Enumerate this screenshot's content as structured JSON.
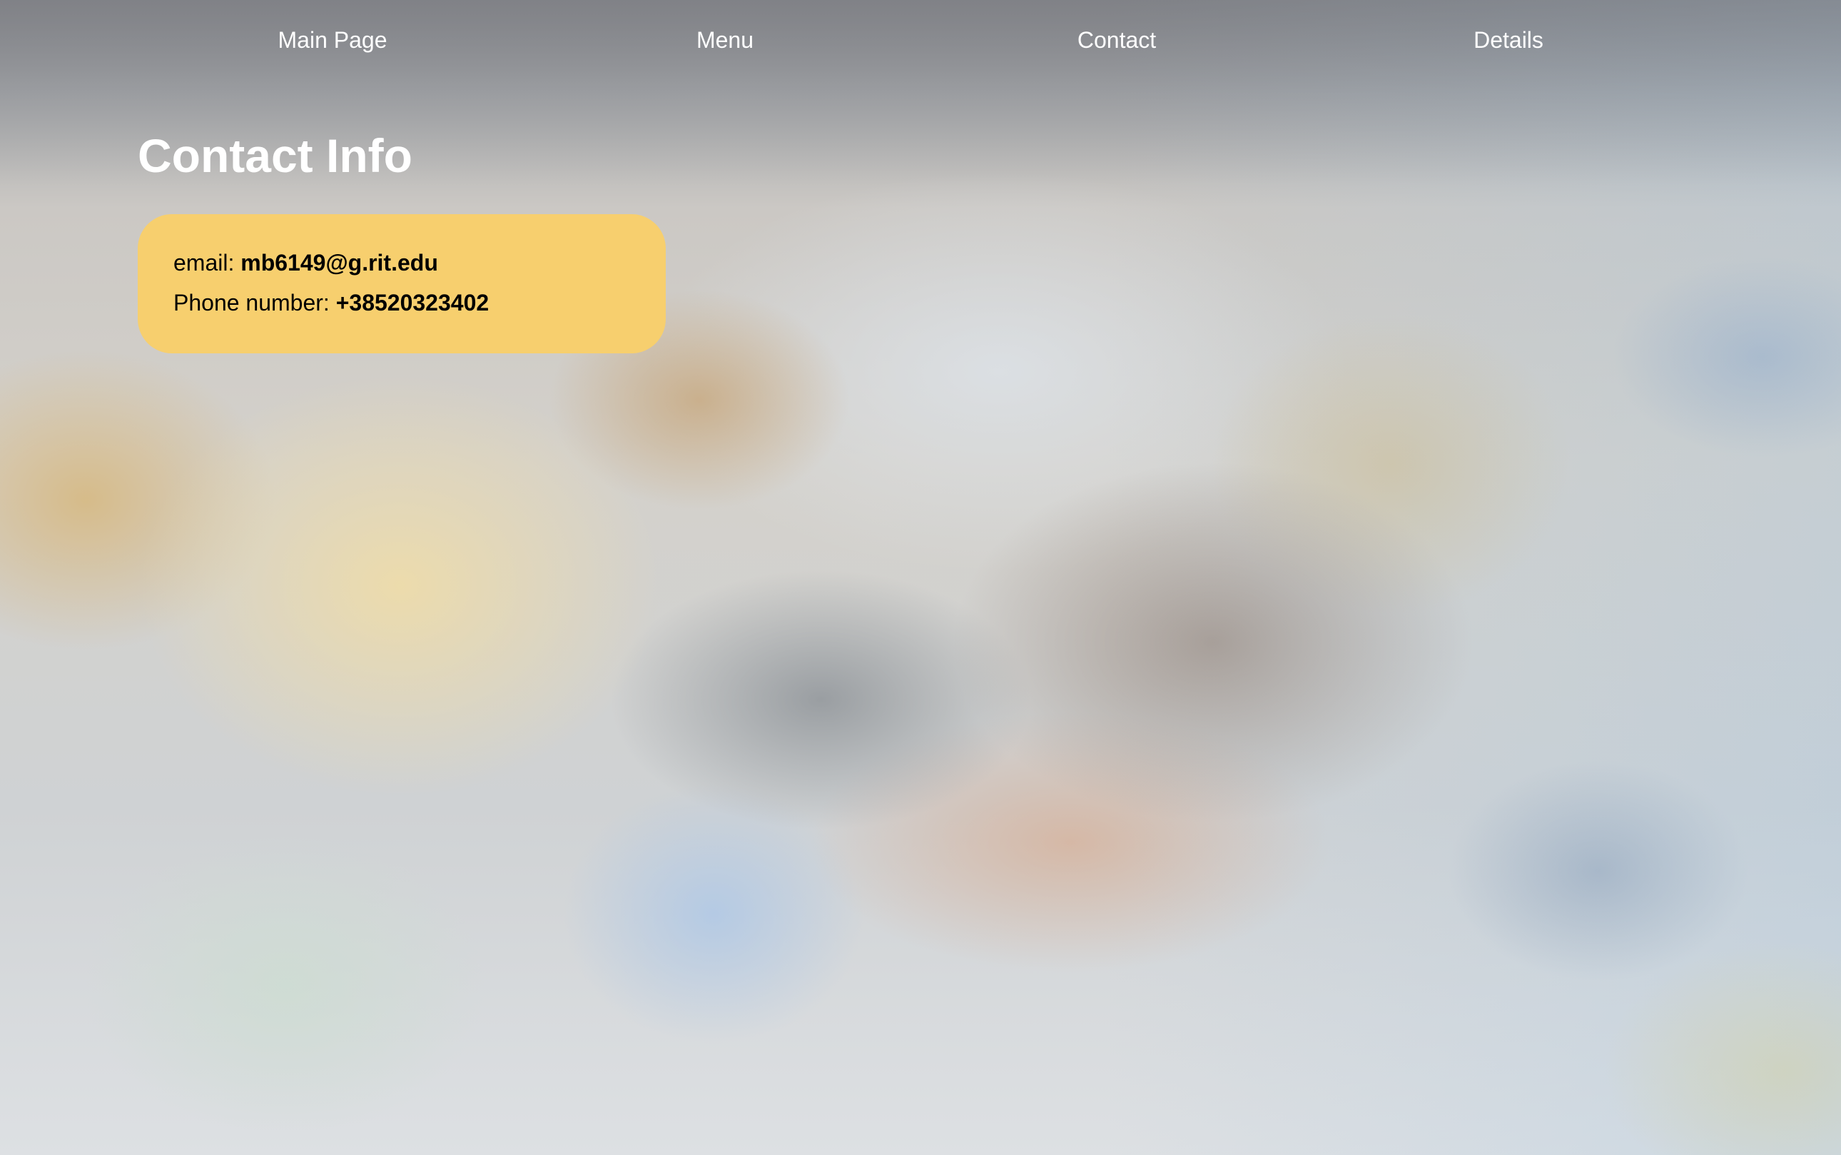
{
  "nav": {
    "items": [
      {
        "label": "Main Page"
      },
      {
        "label": "Menu"
      },
      {
        "label": "Contact"
      },
      {
        "label": "Details"
      }
    ]
  },
  "page": {
    "title": "Contact Info"
  },
  "contact": {
    "email_label": "email:",
    "email_value": "mb6149@g.rit.edu",
    "phone_label": "Phone number:",
    "phone_value": "+38520323402"
  },
  "colors": {
    "card_background": "#f7cf6e",
    "nav_text": "#ffffff",
    "title_text": "#ffffff",
    "card_text": "#000000"
  }
}
